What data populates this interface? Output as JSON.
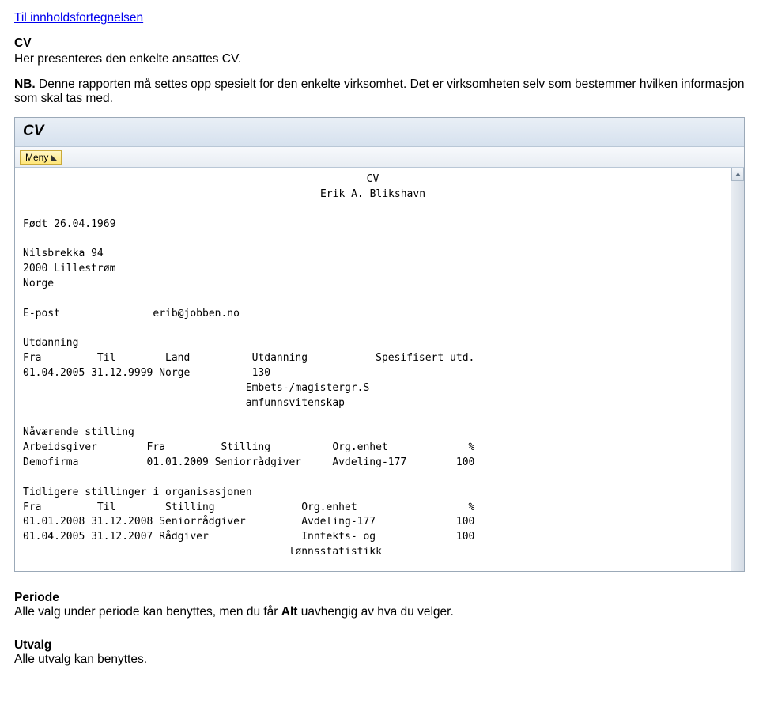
{
  "toc_link": "Til innholdsfortegnelsen",
  "heading": "CV",
  "line1": "Her presenteres den enkelte ansattes CV.",
  "line2_a": "NB.",
  "line2_b": " Denne rapporten må settes opp spesielt for den enkelte virksomhet. Det er virksomheten selv som bestemmer hvilken informasjon som skal tas med.",
  "window_title": "CV",
  "meny_label": "Meny",
  "cv": {
    "title": "CV",
    "name": "Erik A. Blikshavn",
    "born_line": "Født 26.04.1969",
    "addr1": "Nilsbrekka 94",
    "addr2": "2000 Lillestrøm",
    "addr3": "Norge",
    "email_label": "E-post",
    "email_value": "erib@jobben.no",
    "edu_heading": "Utdanning",
    "edu_cols": "Fra         Til        Land          Utdanning           Spesifisert utd.",
    "edu_row1": "01.04.2005 31.12.9999 Norge          130",
    "edu_row2": "                                    Embets-/magistergr.S",
    "edu_row3": "                                    amfunnsvitenskap",
    "cur_heading": "Nåværende stilling",
    "cur_cols": "Arbeidsgiver        Fra         Stilling          Org.enhet             %",
    "cur_row": "Demofirma           01.01.2009 Seniorrådgiver     Avdeling-177        100",
    "prev_heading": "Tidligere stillinger i organisasjonen",
    "prev_cols": "Fra         Til        Stilling              Org.enhet                  %",
    "prev_row1": "01.01.2008 31.12.2008 Seniorrådgiver         Avdeling-177             100",
    "prev_row2": "01.04.2005 31.12.2007 Rådgiver               Inntekts- og             100",
    "prev_row3": "                                           lønnsstatistikk"
  },
  "periode_heading": "Periode",
  "periode_text_a": "Alle valg under periode kan benyttes, men du får ",
  "periode_text_b": "Alt",
  "periode_text_c": " uavhengig av hva du velger.",
  "utvalg_heading": "Utvalg",
  "utvalg_text": "Alle utvalg kan benyttes."
}
